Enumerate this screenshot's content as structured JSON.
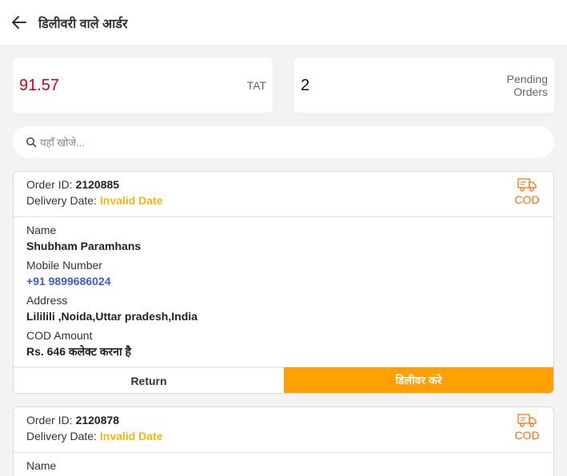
{
  "header": {
    "title": "डिलीवरी वाले आर्डर",
    "back_icon": "arrow-left-icon"
  },
  "stats": {
    "tat_value": "91.57",
    "tat_label": "TAT",
    "pending_value": "2",
    "pending_label_line1": "Pending",
    "pending_label_line2": "Orders"
  },
  "search": {
    "placeholder": "यहाँ खोजे...",
    "value": "",
    "icon": "search-icon"
  },
  "labels": {
    "order_id": "Order ID:",
    "delivery_date": "Delivery Date:",
    "name": "Name",
    "mobile": "Mobile Number",
    "address": "Address",
    "cod_amount": "COD Amount"
  },
  "colors": {
    "accent": "#ff9f00",
    "cod": "#ff6b00",
    "tat": "#d0021b",
    "date_warning": "#f0b90b",
    "phone": "#3b5bdb"
  },
  "orders": [
    {
      "order_id": "2120885",
      "delivery_date": "Invalid Date",
      "payment_type": "COD",
      "name": "Shubham Paramhans",
      "mobile": "+91 9899686024",
      "address": "Lililili ,Noida,Uttar pradesh,India",
      "cod_amount": "Rs. 646 कलेक्ट करना है",
      "return_label": "Return",
      "deliver_label": "डिलीवर करे"
    },
    {
      "order_id": "2120878",
      "delivery_date": "Invalid Date",
      "payment_type": "COD"
    }
  ]
}
